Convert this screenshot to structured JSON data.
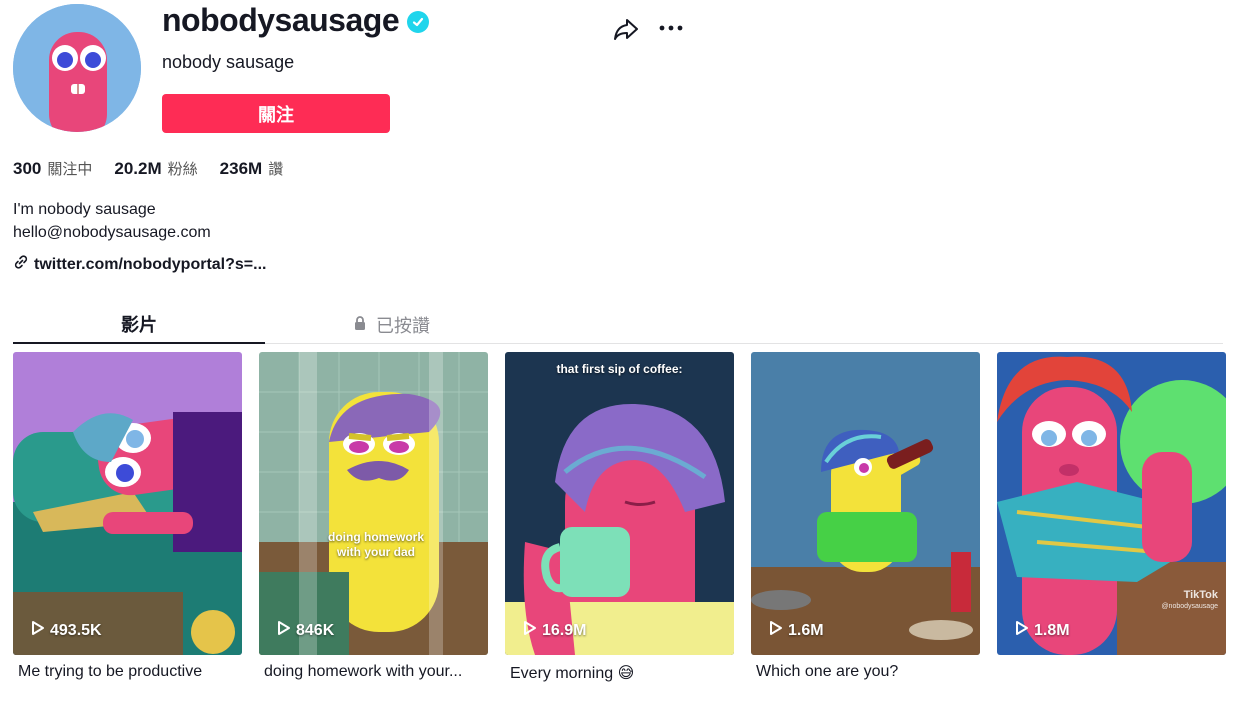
{
  "profile": {
    "username": "nobodysausage",
    "nickname": "nobody sausage",
    "follow_label": "關注",
    "verified": true
  },
  "stats": [
    {
      "value": "300",
      "label": "關注中"
    },
    {
      "value": "20.2M",
      "label": "粉絲"
    },
    {
      "value": "236M",
      "label": "讚"
    }
  ],
  "bio": {
    "line1": "I'm nobody sausage",
    "line2": "hello@nobodysausage.com",
    "link": "twitter.com/nobodyportal?s=..."
  },
  "tabs": {
    "videos": "影片",
    "liked": "已按讚"
  },
  "videos": [
    {
      "views": "493.5K",
      "caption": "Me trying to be productive",
      "overlay": ""
    },
    {
      "views": "846K",
      "caption": "doing homework with your...",
      "overlay": "doing homework with your dad"
    },
    {
      "views": "16.9M",
      "caption": "Every morning 😅",
      "overlay": "that first sip of coffee:"
    },
    {
      "views": "1.6M",
      "caption": "Which one are you?",
      "overlay": ""
    },
    {
      "views": "1.8M",
      "caption": "",
      "overlay": ""
    }
  ],
  "watermark": {
    "brand": "TikTok",
    "handle": "@nobodysausage"
  },
  "colors": {
    "accent": "#fe2c55",
    "verified": "#20d5ec"
  },
  "icons": [
    "verified-icon",
    "share-icon",
    "more-icon",
    "link-icon",
    "lock-icon",
    "play-icon"
  ]
}
